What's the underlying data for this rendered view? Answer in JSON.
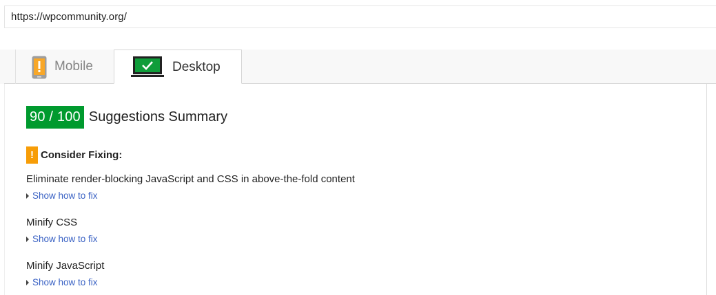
{
  "url_bar": {
    "value": "https://wpcommunity.org/"
  },
  "tabs": [
    {
      "label": "Mobile",
      "icon": "mobile-warning-icon",
      "active": false
    },
    {
      "label": "Desktop",
      "icon": "desktop-check-icon",
      "active": true
    }
  ],
  "summary": {
    "score": "90 / 100",
    "title": "Suggestions Summary",
    "score_color": "#009a2e"
  },
  "consider": {
    "icon": "!",
    "label": "Consider Fixing:",
    "warn_color": "#f79d07"
  },
  "rules": [
    {
      "title": "Eliminate render-blocking JavaScript and CSS in above-the-fold content",
      "link": "Show how to fix"
    },
    {
      "title": "Minify CSS",
      "link": "Show how to fix"
    },
    {
      "title": "Minify JavaScript",
      "link": "Show how to fix"
    }
  ]
}
